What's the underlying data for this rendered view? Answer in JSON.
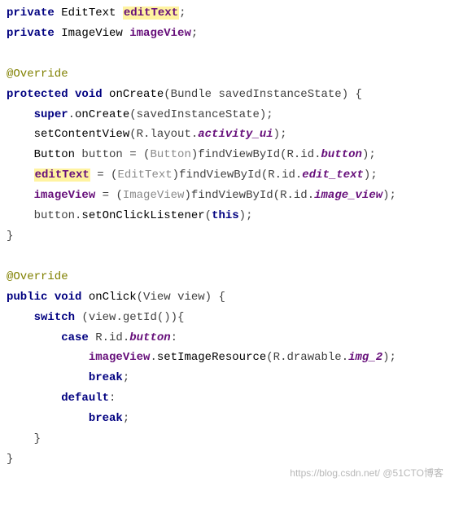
{
  "code": {
    "l1": {
      "kw1": "private",
      "type": "EditText",
      "var": "editText",
      "semi": ";"
    },
    "l2": {
      "kw1": "private",
      "type": "ImageView",
      "var": "imageView",
      "semi": ";"
    },
    "l3": {
      "ann": "@Override"
    },
    "l4": {
      "kw1": "protected",
      "kw2": "void",
      "fn": "onCreate",
      "args": "(Bundle savedInstanceState) {"
    },
    "l5": {
      "kw": "super",
      "dot": ".",
      "fn": "onCreate",
      "args": "(savedInstanceState);"
    },
    "l6": {
      "fn": "setContentView",
      "p1": "(R.layout.",
      "fld": "activity_ui",
      "p2": ");"
    },
    "l7": {
      "type": "Button ",
      "var": "button",
      "eq": " = (",
      "ghost": "Button",
      "mid": ")findViewById(R.id.",
      "fld": "button",
      "end": ");"
    },
    "l8": {
      "var": "editText",
      "eq": " = (",
      "ghost": "EditText",
      "mid": ")findViewById(R.id.",
      "fld": "edit_text",
      "end": ");"
    },
    "l9": {
      "var": "imageView",
      "eq": " = (",
      "ghost": "ImageView",
      "mid": ")findViewById(R.id.",
      "fld": "image_view",
      "end": ");"
    },
    "l10": {
      "obj": "button.",
      "fn": "setOnClickListener",
      "p1": "(",
      "kw": "this",
      "p2": ");"
    },
    "l11": {
      "brace": "}"
    },
    "l12": {
      "ann": "@Override"
    },
    "l13": {
      "kw1": "public",
      "kw2": "void",
      "fn": "onClick",
      "args": "(View view) {"
    },
    "l14": {
      "kw": "switch",
      "rest": " (view.getId()){"
    },
    "l15": {
      "kw": "case",
      "pre": " R.id.",
      "fld": "button",
      "colon": ":"
    },
    "l16": {
      "var": "imageView",
      "dot": ".",
      "fn": "setImageResource",
      "p1": "(R.drawable.",
      "fld": "img_2",
      "p2": ");"
    },
    "l17": {
      "kw": "break",
      "semi": ";"
    },
    "l18": {
      "kw": "default",
      "colon": ":"
    },
    "l19": {
      "kw": "break",
      "semi": ";"
    },
    "l20": {
      "brace": "}"
    },
    "l21": {
      "brace": "}"
    }
  },
  "watermark": "https://blog.csdn.net/ @51CTO博客"
}
